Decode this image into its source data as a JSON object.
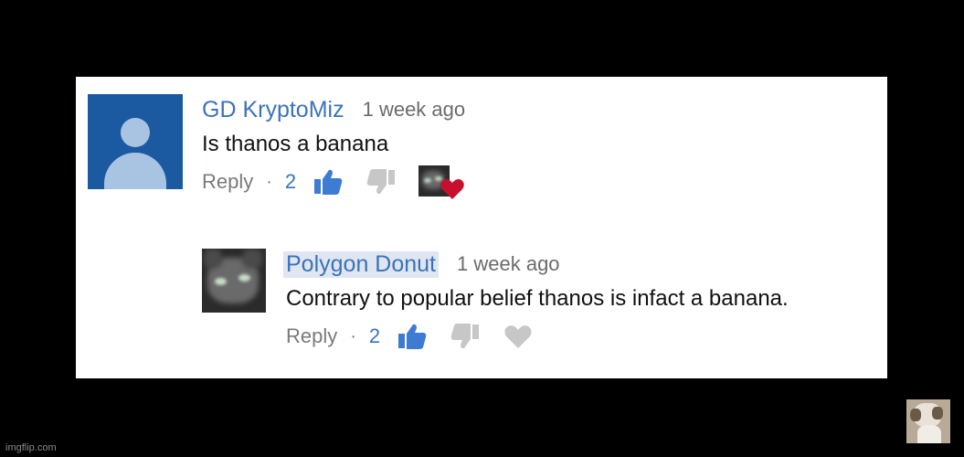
{
  "comments": [
    {
      "author": "GD KryptoMiz",
      "time": "1 week ago",
      "text": "Is thanos a banana",
      "reply_label": "Reply",
      "separator": "·",
      "likes": "2",
      "avatar": "default-user-avatar",
      "creator_heart": true
    },
    {
      "author": "Polygon Donut",
      "time": "1 week ago",
      "text": "Contrary to popular belief thanos is infact a banana.",
      "reply_label": "Reply",
      "separator": "·",
      "likes": "2",
      "avatar": "cat-avatar",
      "creator_heart": false
    }
  ],
  "colors": {
    "author_blue": "#3b73b8",
    "like_blue": "#3e7bd2",
    "heart_red": "#c8102e",
    "background": "#000000",
    "card": "#ffffff"
  },
  "watermark": "imgflip.com"
}
